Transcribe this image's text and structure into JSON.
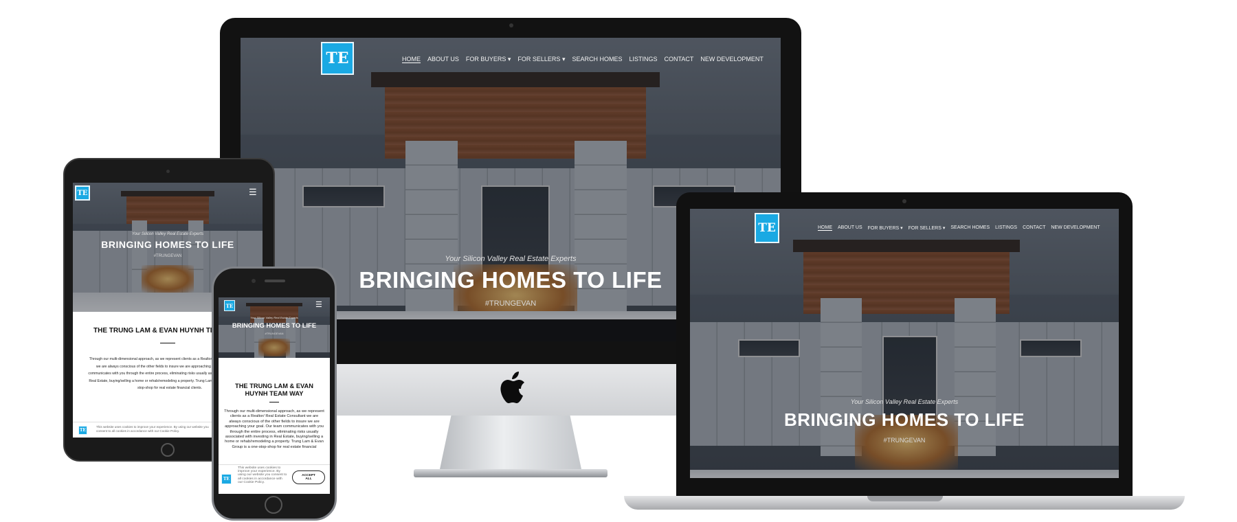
{
  "brand": {
    "logo_text": "TE",
    "accent_color": "#1aa9e3"
  },
  "nav": {
    "items": [
      "Home",
      "About Us",
      "For Buyers",
      "For Sellers",
      "Search Homes",
      "Listings",
      "Contact",
      "New Development"
    ],
    "dropdown_caret": "▾"
  },
  "hero": {
    "tagline": "Your Silicon Valley Real Estate Experts",
    "headline": "BRINGING HOMES TO LIFE",
    "hashtag": "#TRUNGEVAN"
  },
  "section": {
    "title": "THE TRUNG LAM & EVAN HUYNH TEAM WAY",
    "tablet_title": "THE TRUNG LAM & EVAN HUYNH TE",
    "body": "Through our multi-dimensional approach, as we represent clients as a Realtor/ Real Estate Consultant we are always conscious of the other fields to insure we are approaching your goal. Our team communicates with you through the entire process, eliminating risks usually associated with investing in Real Estate, buying/selling a home or rehab/remodeling a property. Trung Lam & Evan Group is a one-stop-shop for real estate financial clients.",
    "phone_body": "Through our multi-dimensional approach, as we represent clients as a Realtor/ Real Estate Consultant we are always conscious of the other fields to insure we are approaching your goal. Our team communicates with you through the entire process, eliminating risks usually associated with investing in Real Estate, buying/selling a home or rehab/remodeling a property. Trung Lam & Evan Group is a one-stop-shop for real estate financial"
  },
  "cookie": {
    "text": "This website uses cookies to improve your experience. By using our website you consent to all cookies in accordance with our Cookie Policy.",
    "tablet_text": "This website uses cookies to improve your experience. By using our website you consent to all cookies in accordance with our Cookie Policy.",
    "accept_label": "ACCEPT ALL"
  },
  "icons": {
    "menu": "hamburger-icon",
    "apple": "apple-logo-icon"
  }
}
